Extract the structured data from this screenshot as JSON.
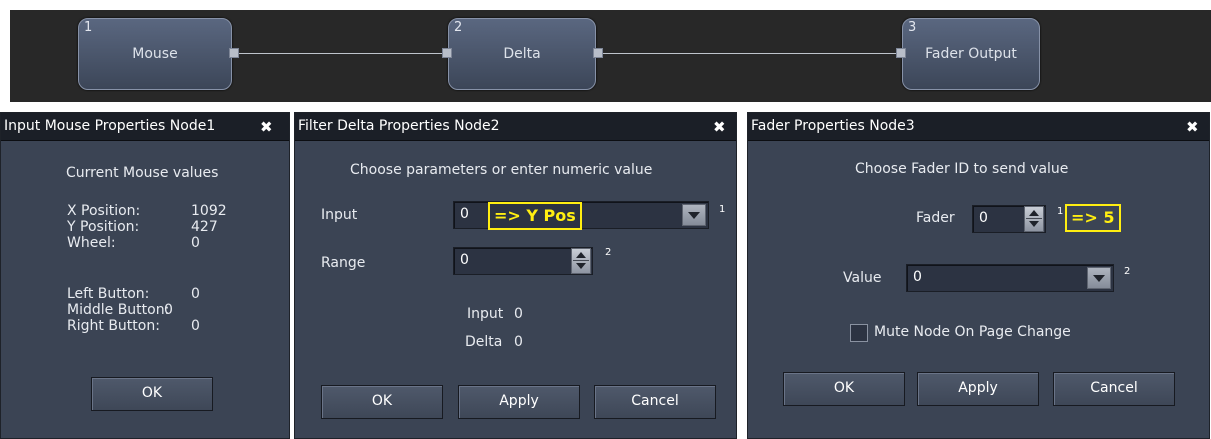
{
  "graph": {
    "nodes": [
      {
        "number": "1",
        "label": "Mouse"
      },
      {
        "number": "2",
        "label": "Delta"
      },
      {
        "number": "3",
        "label": "Fader Output"
      }
    ]
  },
  "mouse_dialog": {
    "title": "Input Mouse Properties Node1",
    "heading": "Current Mouse values",
    "rows": [
      {
        "label": "X Position:",
        "value": "1092"
      },
      {
        "label": "Y Position:",
        "value": "427"
      },
      {
        "label": "Wheel:",
        "value": "0"
      },
      {
        "label": "Left Button:",
        "value": "0"
      },
      {
        "label": "Middle Button:",
        "value": "0"
      },
      {
        "label": "Right Button:",
        "value": "0"
      }
    ],
    "ok_label": "OK"
  },
  "delta_dialog": {
    "title": "Filter Delta Properties Node2",
    "heading": "Choose parameters or enter numeric value",
    "input_label": "Input",
    "input_value": "0",
    "input_annotation": "=> Y Pos",
    "input_index": "1",
    "range_label": "Range",
    "range_value": "0",
    "range_index": "2",
    "readout_input_label": "Input",
    "readout_input_value": "0",
    "readout_delta_label": "Delta",
    "readout_delta_value": "0",
    "ok_label": "OK",
    "apply_label": "Apply",
    "cancel_label": "Cancel"
  },
  "fader_dialog": {
    "title": "Fader Properties Node3",
    "heading": "Choose Fader ID to send value",
    "fader_label": "Fader",
    "fader_value": "0",
    "fader_index": "1",
    "fader_annotation": "=> 5",
    "value_label": "Value",
    "value_value": "0",
    "value_index": "2",
    "mute_label": "Mute Node On Page Change",
    "ok_label": "OK",
    "apply_label": "Apply",
    "cancel_label": "Cancel"
  },
  "icons": {
    "close": "close-icon",
    "dropdown": "chevron-down-icon",
    "spinner": "spinner-icon"
  },
  "colors": {
    "annotation": "#ffee11",
    "panel": "#3b4454",
    "titlebar": "#1b1f27",
    "graph_bg": "#282828"
  }
}
